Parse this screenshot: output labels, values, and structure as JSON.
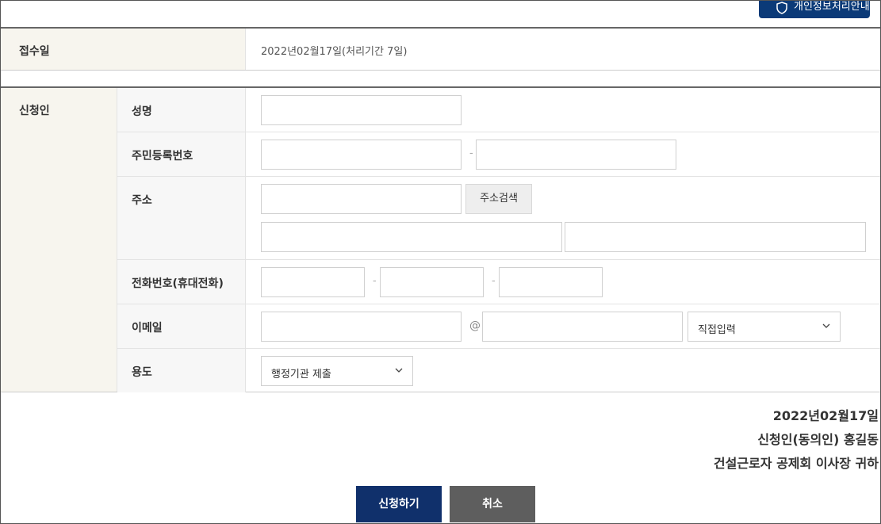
{
  "top_button": {
    "label": "개인정보처리안내",
    "icon": "shield-icon"
  },
  "receipt": {
    "label": "접수일",
    "value": "2022년02월17일(처리기간 7일)"
  },
  "applicant": {
    "section_label": "신청인",
    "name_label": "성명",
    "rrn_label": "주민등록번호",
    "rrn_sep": "-",
    "address_label": "주소",
    "address_search_label": "주소검색",
    "phone_label": "전화번호(휴대전화)",
    "phone_sep": "-",
    "email_label": "이메일",
    "email_at": "@",
    "email_domain_select": "직접입력",
    "purpose_label": "용도",
    "purpose_select": "행정기관 제출"
  },
  "signature": {
    "date": "2022년02월17일",
    "applicant": "신청인(동의인) 홍길동",
    "recipient": "건설근로자 공제회 이사장 귀하"
  },
  "buttons": {
    "submit": "신청하기",
    "cancel": "취소"
  }
}
